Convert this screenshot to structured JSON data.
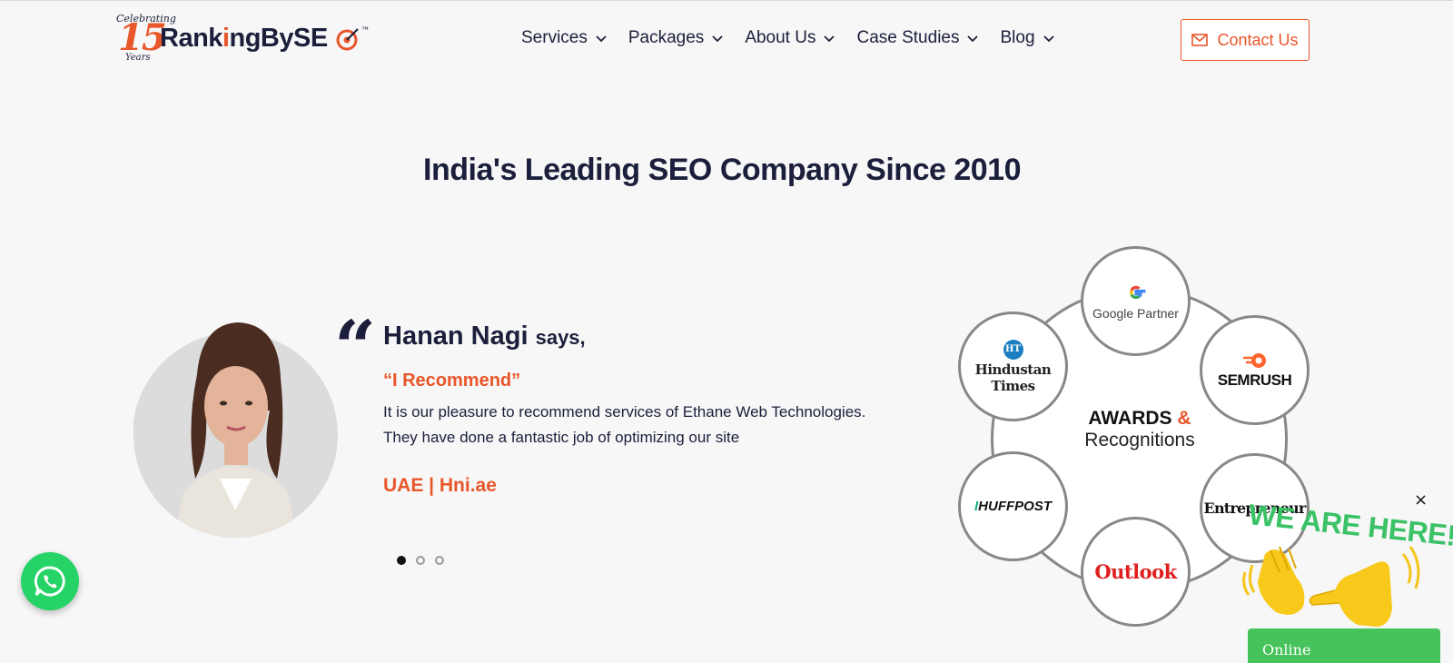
{
  "header": {
    "logo": {
      "celebrating": "Celebrating",
      "number": "15",
      "years": "Years",
      "brand_prefix": "Rank",
      "brand_i": "i",
      "brand_mid": "ngBySE",
      "tm": "™"
    },
    "nav": [
      {
        "label": "Services"
      },
      {
        "label": "Packages"
      },
      {
        "label": "About Us"
      },
      {
        "label": "Case Studies"
      },
      {
        "label": "Blog"
      }
    ],
    "contact_label": "Contact Us"
  },
  "main": {
    "title": "India's Leading SEO Company Since 2010"
  },
  "testimonial": {
    "quote_mark": "“",
    "name": "Hanan Nagi",
    "says": "says,",
    "headline": "“I Recommend”",
    "body": "It is our pleasure to recommend services of Ethane Web Technologies. They have done a fantastic job of optimizing our site",
    "source": "UAE | Hni.ae",
    "dots": [
      true,
      false,
      false
    ]
  },
  "awards": {
    "center_line1": "AWARDS",
    "center_amp": "&",
    "center_line2": "Recognitions",
    "google_partner": "Google Partner",
    "hindustan_times_mark": "HT",
    "hindustan_times": "Hindustan Times",
    "semrush": "SEMRUSH",
    "huffpost_bar": "I",
    "huffpost": "HUFFPOST",
    "entrepreneur": "Entrepreneur",
    "outlook": "Outlook"
  },
  "chat": {
    "we_are_here": "WE ARE HERE!",
    "close": "×",
    "online": "Online"
  },
  "colors": {
    "accent": "#e8562a",
    "navy": "#1b1f3b",
    "whatsapp": "#25d366",
    "online": "#46c35b"
  }
}
